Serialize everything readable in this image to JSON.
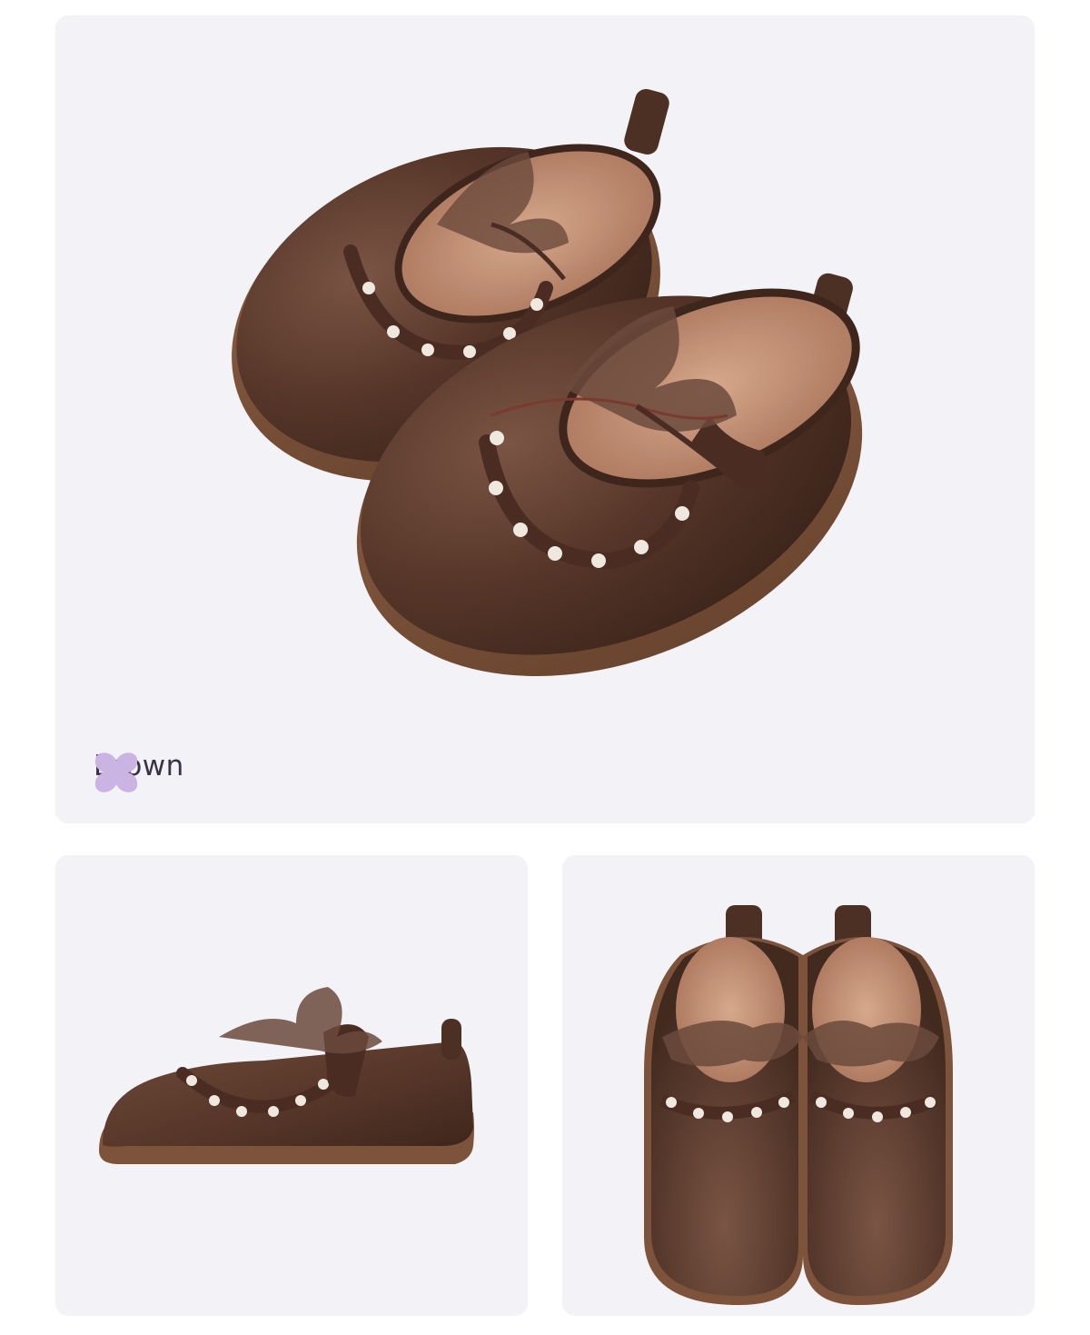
{
  "product": {
    "color_name": "Brown",
    "swatch_color": "#c9b4e4",
    "shoe_color": "#5a3a2c",
    "sole_color": "#7e533b",
    "lining_color": "#c8947a",
    "bow_color": "#6b4a3c",
    "pearl_color": "#f1ece4",
    "background_color": "#f3f2f6"
  },
  "views": [
    {
      "name": "pair-three-quarter-view"
    },
    {
      "name": "side-profile-view"
    },
    {
      "name": "top-down-pair-view"
    }
  ]
}
